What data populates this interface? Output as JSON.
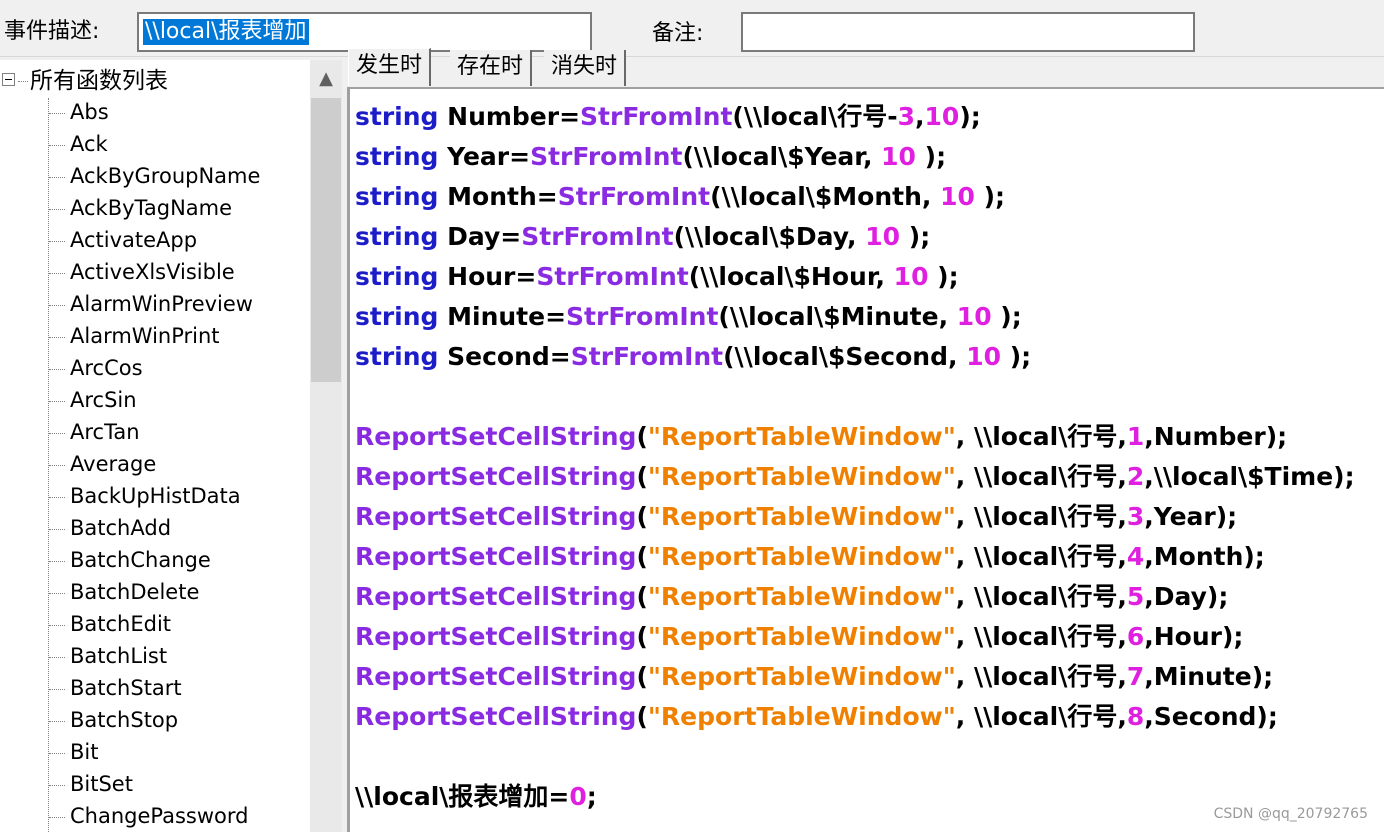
{
  "header": {
    "event_label": "事件描述:",
    "event_value": "\\\\local\\报表增加",
    "note_label": "备注:",
    "note_value": ""
  },
  "tree": {
    "root_label": "所有函数列表",
    "items": [
      "Abs",
      "Ack",
      "AckByGroupName",
      "AckByTagName",
      "ActivateApp",
      "ActiveXlsVisible",
      "AlarmWinPreview",
      "AlarmWinPrint",
      "ArcCos",
      "ArcSin",
      "ArcTan",
      "Average",
      "BackUpHistData",
      "BatchAdd",
      "BatchChange",
      "BatchDelete",
      "BatchEdit",
      "BatchList",
      "BatchStart",
      "BatchStop",
      "Bit",
      "BitSet",
      "ChangePassword"
    ],
    "scroll_up_icon": "▲"
  },
  "tabs": [
    {
      "label": "发生时",
      "active": true
    },
    {
      "label": "存在时",
      "active": false
    },
    {
      "label": "消失时",
      "active": false
    }
  ],
  "code": [
    [
      [
        "keyword",
        "string"
      ],
      [
        "plain",
        " Number="
      ],
      [
        "func",
        "StrFromInt"
      ],
      [
        "plain",
        "(\\\\local\\行号-"
      ],
      [
        "num",
        "3"
      ],
      [
        "plain",
        ","
      ],
      [
        "num",
        "10"
      ],
      [
        "plain",
        ");"
      ]
    ],
    [
      [
        "keyword",
        "string"
      ],
      [
        "plain",
        " Year="
      ],
      [
        "func",
        "StrFromInt"
      ],
      [
        "plain",
        "(\\\\local\\$Year, "
      ],
      [
        "num",
        "10"
      ],
      [
        "plain",
        " );"
      ]
    ],
    [
      [
        "keyword",
        "string"
      ],
      [
        "plain",
        " Month="
      ],
      [
        "func",
        "StrFromInt"
      ],
      [
        "plain",
        "(\\\\local\\$Month, "
      ],
      [
        "num",
        "10"
      ],
      [
        "plain",
        " );"
      ]
    ],
    [
      [
        "keyword",
        "string"
      ],
      [
        "plain",
        " Day="
      ],
      [
        "func",
        "StrFromInt"
      ],
      [
        "plain",
        "(\\\\local\\$Day, "
      ],
      [
        "num",
        "10"
      ],
      [
        "plain",
        " );"
      ]
    ],
    [
      [
        "keyword",
        "string"
      ],
      [
        "plain",
        " Hour="
      ],
      [
        "func",
        "StrFromInt"
      ],
      [
        "plain",
        "(\\\\local\\$Hour, "
      ],
      [
        "num",
        "10"
      ],
      [
        "plain",
        " );"
      ]
    ],
    [
      [
        "keyword",
        "string"
      ],
      [
        "plain",
        " Minute="
      ],
      [
        "func",
        "StrFromInt"
      ],
      [
        "plain",
        "(\\\\local\\$Minute, "
      ],
      [
        "num",
        "10"
      ],
      [
        "plain",
        " );"
      ]
    ],
    [
      [
        "keyword",
        "string"
      ],
      [
        "plain",
        " Second="
      ],
      [
        "func",
        "StrFromInt"
      ],
      [
        "plain",
        "(\\\\local\\$Second, "
      ],
      [
        "num",
        "10"
      ],
      [
        "plain",
        " );"
      ]
    ],
    [],
    [
      [
        "func",
        "ReportSetCellString"
      ],
      [
        "plain",
        "("
      ],
      [
        "str",
        "\"ReportTableWindow\""
      ],
      [
        "plain",
        ", \\\\local\\行号,"
      ],
      [
        "num",
        "1"
      ],
      [
        "plain",
        ",Number);"
      ]
    ],
    [
      [
        "func",
        "ReportSetCellString"
      ],
      [
        "plain",
        "("
      ],
      [
        "str",
        "\"ReportTableWindow\""
      ],
      [
        "plain",
        ", \\\\local\\行号,"
      ],
      [
        "num",
        "2"
      ],
      [
        "plain",
        ",\\\\local\\$Time);"
      ]
    ],
    [
      [
        "func",
        "ReportSetCellString"
      ],
      [
        "plain",
        "("
      ],
      [
        "str",
        "\"ReportTableWindow\""
      ],
      [
        "plain",
        ", \\\\local\\行号,"
      ],
      [
        "num",
        "3"
      ],
      [
        "plain",
        ",Year);"
      ]
    ],
    [
      [
        "func",
        "ReportSetCellString"
      ],
      [
        "plain",
        "("
      ],
      [
        "str",
        "\"ReportTableWindow\""
      ],
      [
        "plain",
        ", \\\\local\\行号,"
      ],
      [
        "num",
        "4"
      ],
      [
        "plain",
        ",Month);"
      ]
    ],
    [
      [
        "func",
        "ReportSetCellString"
      ],
      [
        "plain",
        "("
      ],
      [
        "str",
        "\"ReportTableWindow\""
      ],
      [
        "plain",
        ", \\\\local\\行号,"
      ],
      [
        "num",
        "5"
      ],
      [
        "plain",
        ",Day);"
      ]
    ],
    [
      [
        "func",
        "ReportSetCellString"
      ],
      [
        "plain",
        "("
      ],
      [
        "str",
        "\"ReportTableWindow\""
      ],
      [
        "plain",
        ", \\\\local\\行号,"
      ],
      [
        "num",
        "6"
      ],
      [
        "plain",
        ",Hour);"
      ]
    ],
    [
      [
        "func",
        "ReportSetCellString"
      ],
      [
        "plain",
        "("
      ],
      [
        "str",
        "\"ReportTableWindow\""
      ],
      [
        "plain",
        ", \\\\local\\行号,"
      ],
      [
        "num",
        "7"
      ],
      [
        "plain",
        ",Minute);"
      ]
    ],
    [
      [
        "func",
        "ReportSetCellString"
      ],
      [
        "plain",
        "("
      ],
      [
        "str",
        "\"ReportTableWindow\""
      ],
      [
        "plain",
        ", \\\\local\\行号,"
      ],
      [
        "num",
        "8"
      ],
      [
        "plain",
        ",Second);"
      ]
    ],
    [],
    [
      [
        "plain",
        "\\\\local\\报表增加="
      ],
      [
        "num",
        "0"
      ],
      [
        "plain",
        ";"
      ]
    ]
  ],
  "watermark": "CSDN @qq_20792765"
}
